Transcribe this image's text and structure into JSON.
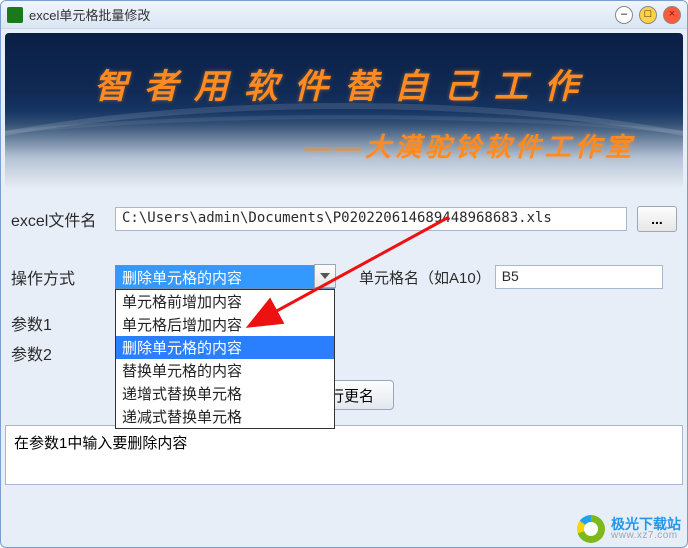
{
  "window": {
    "title": "excel单元格批量修改"
  },
  "banner": {
    "line1": "智者用软件替自己工作",
    "line2": "——大漠驼铃软件工作室"
  },
  "file": {
    "label": "excel文件名",
    "path": "C:\\Users\\admin\\Documents\\P020220614689448968683.xls",
    "browse": "..."
  },
  "operation": {
    "label": "操作方式",
    "selected": "删除单元格的内容",
    "options": [
      "单元格前增加内容",
      "单元格后增加内容",
      "删除单元格的内容",
      "替换单元格的内容",
      "递增式替换单元格",
      "递减式替换单元格"
    ],
    "cell_label": "单元格名（如A10）",
    "cell_value": "B5"
  },
  "params": {
    "p1_label": "参数1",
    "p1_value": "",
    "p2_label": "参数2",
    "p2_value": ""
  },
  "execute": "执行更名",
  "log": "在参数1中输入要删除内容",
  "watermark": {
    "name": "极光下载站",
    "url": "www.xz7.com"
  }
}
